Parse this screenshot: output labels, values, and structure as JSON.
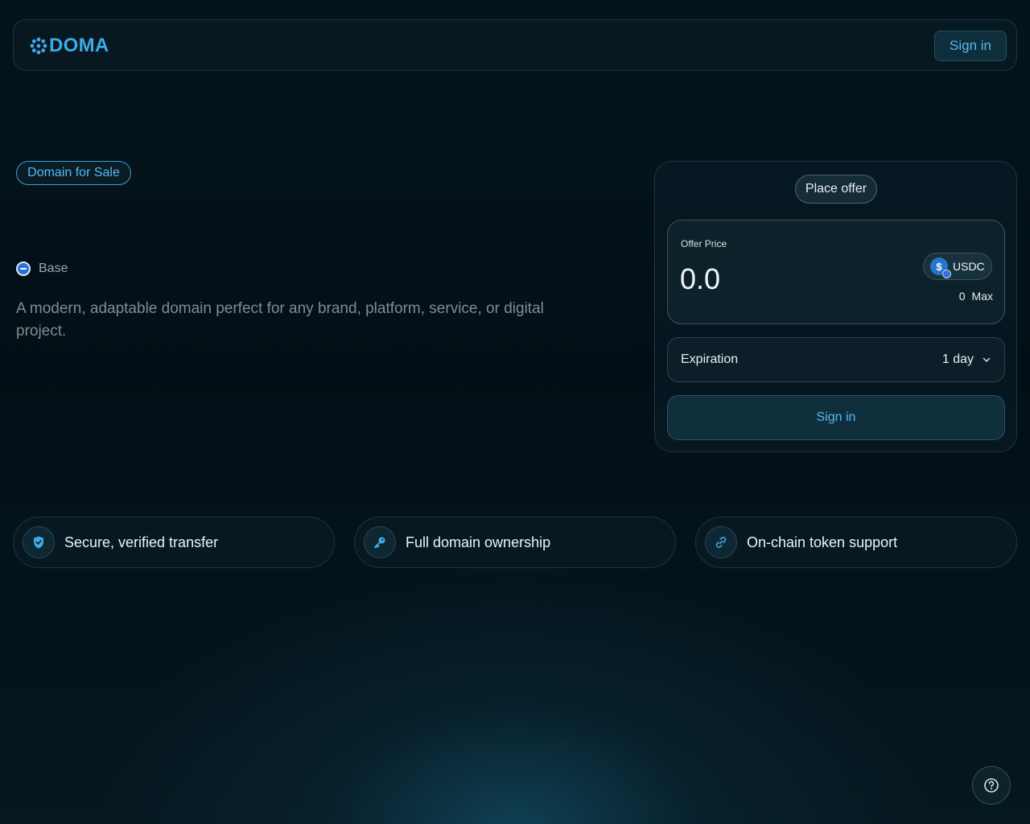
{
  "header": {
    "logo_text": "DOMA",
    "signin_label": "Sign in"
  },
  "listing": {
    "badge": "Domain for Sale",
    "network": "Base",
    "description": "A modern, adaptable domain perfect for any brand, platform, service, or digital project."
  },
  "offer": {
    "tab_label": "Place offer",
    "price_label": "Offer Price",
    "price_value": "0.0",
    "token": "USDC",
    "balance": "0",
    "max_label": "Max",
    "expiration_label": "Expiration",
    "expiration_value": "1 day",
    "signin_label": "Sign in"
  },
  "features": [
    {
      "label": "Secure, verified transfer",
      "icon": "shield-check-icon"
    },
    {
      "label": "Full domain ownership",
      "icon": "key-icon"
    },
    {
      "label": "On-chain token support",
      "icon": "link-icon"
    }
  ],
  "colors": {
    "accent": "#3fa9e8",
    "background": "#04141c"
  }
}
